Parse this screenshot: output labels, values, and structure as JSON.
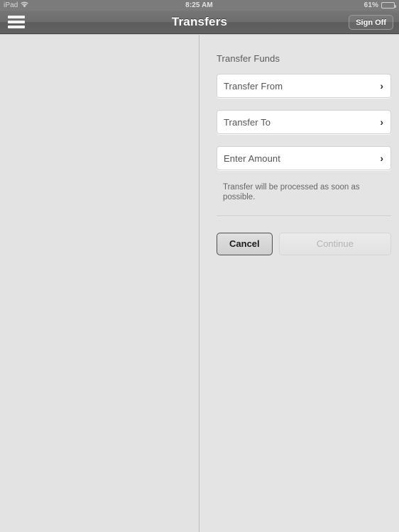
{
  "status_bar": {
    "carrier": "iPad",
    "wifi_icon": "wifi-icon",
    "time": "8:25 AM",
    "battery_percent": "61%",
    "battery_level": 61
  },
  "nav_bar": {
    "menu_icon": "hamburger-menu-icon",
    "title": "Transfers",
    "sign_off_label": "Sign Off"
  },
  "main": {
    "section_title": "Transfer Funds",
    "fields": [
      {
        "label": "Transfer From",
        "chevron": "›"
      },
      {
        "label": "Transfer To",
        "chevron": "›"
      },
      {
        "label": "Enter Amount",
        "chevron": "›"
      }
    ],
    "helper_text": "Transfer will be processed as soon as possible.",
    "buttons": {
      "cancel_label": "Cancel",
      "continue_label": "Continue"
    }
  },
  "colors": {
    "nav_bar": "#6d6d6d",
    "background": "#e4e4e4",
    "field_background": "#ffffff",
    "disabled_text": "#b4b4b4"
  }
}
